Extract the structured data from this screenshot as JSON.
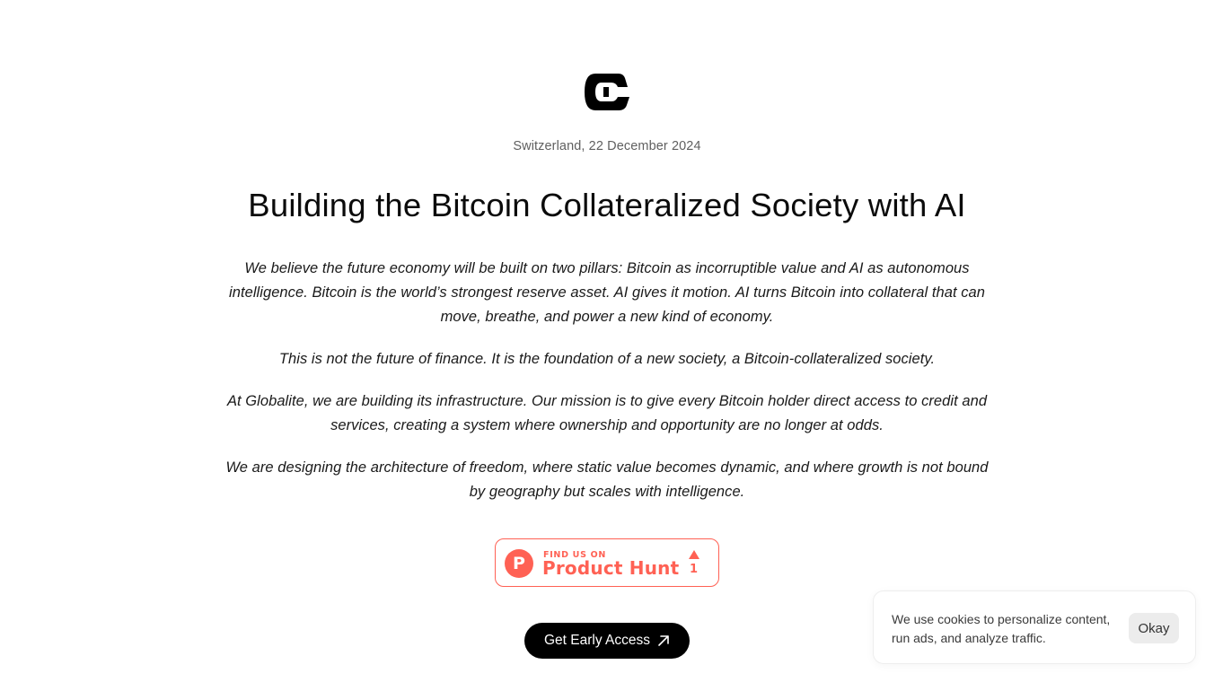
{
  "header": {
    "logo_icon": "globalite-logo-icon",
    "dateline": "Switzerland, 22 December 2024"
  },
  "main": {
    "title": "Building the Bitcoin Collateralized Society with AI",
    "paragraphs": [
      "We believe the future economy will be built on two pillars: Bitcoin as incorruptible value and AI as autonomous intelligence. Bitcoin is the world’s strongest reserve asset. AI gives it motion. AI turns Bitcoin into collateral that can move, breathe, and power a new kind of economy.",
      "This is not the future of finance. It is the foundation of a new society, a Bitcoin-collateralized society.",
      "At Globalite, we are building its infrastructure. Our mission is to give every Bitcoin holder direct access to credit and services, creating a system where ownership and opportunity are no longer at odds.",
      "We are designing the architecture of freedom, where static value becomes dynamic, and where growth is not bound by geography but scales with intelligence."
    ]
  },
  "product_hunt": {
    "logo_letter": "P",
    "find_label": "FIND US ON",
    "name": "Product Hunt",
    "upvotes": "1",
    "color": "#ff6154"
  },
  "cta": {
    "label": "Get Early Access",
    "icon": "arrow-up-right-icon"
  },
  "cookie_banner": {
    "text": "We use cookies to personalize content, run ads, and analyze traffic.",
    "button_label": "Okay"
  }
}
